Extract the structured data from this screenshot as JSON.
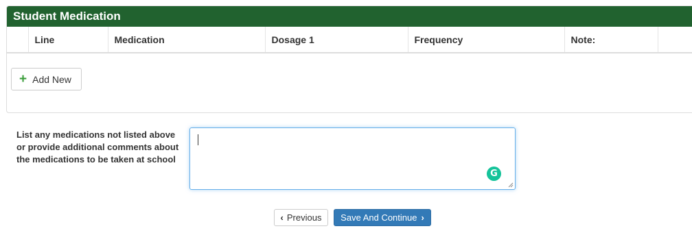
{
  "panel": {
    "title": "Student Medication",
    "header_color": "#21622f",
    "columns": [
      "",
      "Line",
      "Medication",
      "Dosage 1",
      "Frequency",
      "Note:",
      ""
    ],
    "rows": [],
    "add_new_label": "Add New"
  },
  "comments": {
    "label": "List any medications not listed above or provide additional comments about the medications to be taken at school",
    "value": ""
  },
  "nav": {
    "previous_label": "Previous",
    "continue_label": "Save And Continue",
    "continue_color": "#337ab7"
  },
  "icons": {
    "add": "plus-icon",
    "grammarly": "grammarly-icon",
    "previous": "chevron-left-icon",
    "next": "chevron-right-icon"
  }
}
